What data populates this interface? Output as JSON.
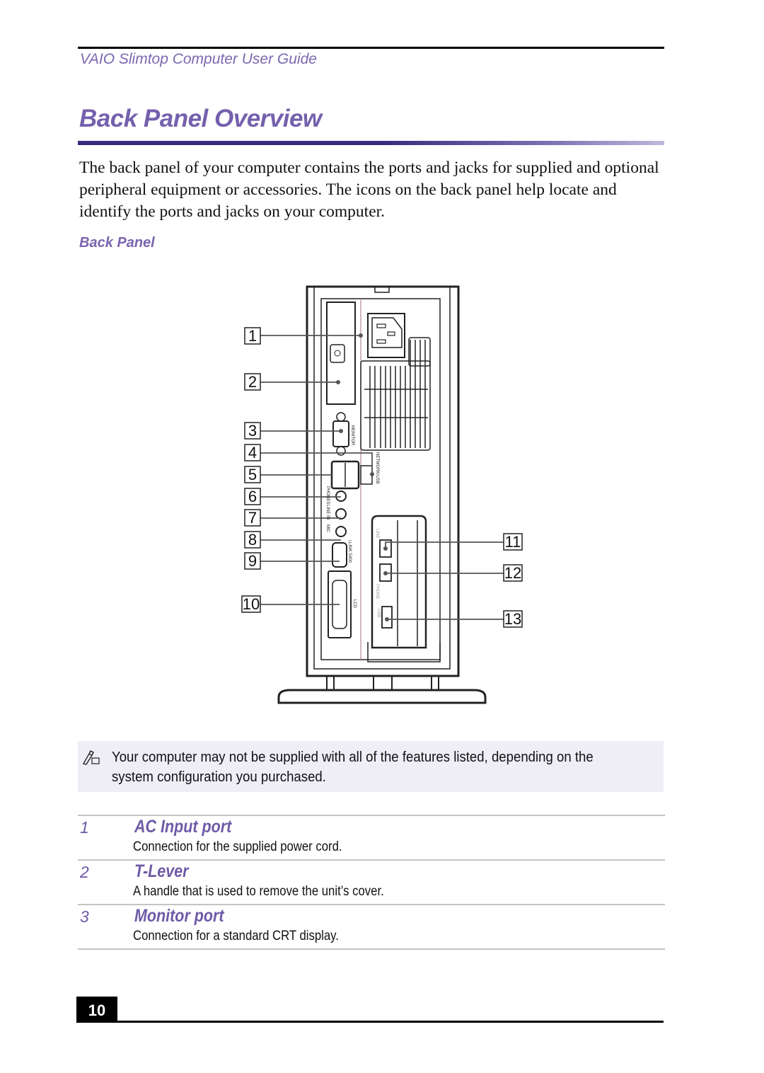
{
  "header": {
    "guide_title": "VAIO Slimtop Computer User Guide"
  },
  "page": {
    "title": "Back Panel Overview",
    "intro": "The back panel of your computer contains the ports and jacks for supplied and optional peripheral equipment or accessories. The icons on the back panel help locate and identify the ports and jacks on your computer.",
    "figure_caption": "Back Panel",
    "page_number": "10"
  },
  "figure": {
    "callouts": [
      "1",
      "2",
      "3",
      "4",
      "5",
      "6",
      "7",
      "8",
      "9",
      "10",
      "11",
      "12",
      "13"
    ],
    "panel_labels": {
      "monitor": "MONITOR",
      "network_usb": "NETWORK/USB",
      "phones": "PHONES",
      "line_in": "LINE IN",
      "mic": "MIC",
      "ilink": "i.LINK S400",
      "lcd": "LCD",
      "line": "LINE",
      "phone": "PHONE",
      "usb": "USB"
    }
  },
  "note": {
    "icon": "pencil-note-icon",
    "text_line1": "Your computer may not be supplied with all of the features listed, depending on the",
    "text_line2": "system configuration you purchased."
  },
  "items": [
    {
      "number": "1",
      "title": "AC Input port",
      "description": "Connection for the supplied power cord."
    },
    {
      "number": "2",
      "title": "T-Lever",
      "description": "A handle that is used to remove the unit’s cover."
    },
    {
      "number": "3",
      "title": "Monitor port",
      "description": "Connection for a standard CRT display."
    }
  ],
  "colors": {
    "accent": "#7560ad",
    "title_rule_dark": "#3a2a7e",
    "note_background": "#efedf6"
  }
}
